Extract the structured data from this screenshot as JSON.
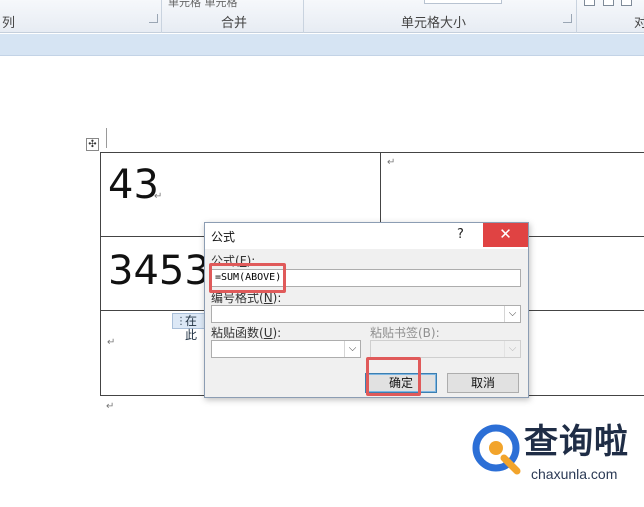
{
  "ribbon": {
    "left_fragment": "列",
    "merge_label": "合并",
    "cell_size_label": "单元格大小",
    "right_fragment": "对",
    "top_sub_fragment": "单元格 单元格"
  },
  "document": {
    "cell_values": [
      "43",
      "3453"
    ],
    "paragraph_mark": "↵",
    "move_handle_glyph": "✣",
    "tooltip_text": "在此"
  },
  "dialog": {
    "title": "公式",
    "help": "?",
    "close": "✕",
    "formula_label_prefix": "公式(",
    "formula_label_key": "F",
    "formula_label_suffix": "):",
    "formula_value": "=SUM(ABOVE)",
    "number_format_label_prefix": "编号格式(",
    "number_format_label_key": "N",
    "number_format_label_suffix": "):",
    "number_format_value": "",
    "paste_function_label_prefix": "粘贴函数(",
    "paste_function_label_key": "U",
    "paste_function_label_suffix": "):",
    "paste_function_value": "",
    "paste_bookmark_label": "粘贴书签(B):",
    "paste_bookmark_value": "",
    "ok": "确定",
    "cancel": "取消"
  },
  "watermark": {
    "brand_cn": "查询啦",
    "brand_url": "chaxunla.com"
  },
  "colors": {
    "highlight": "#e05a5a",
    "close_button": "#e04343",
    "ribbon_band": "#d6e4f3"
  }
}
